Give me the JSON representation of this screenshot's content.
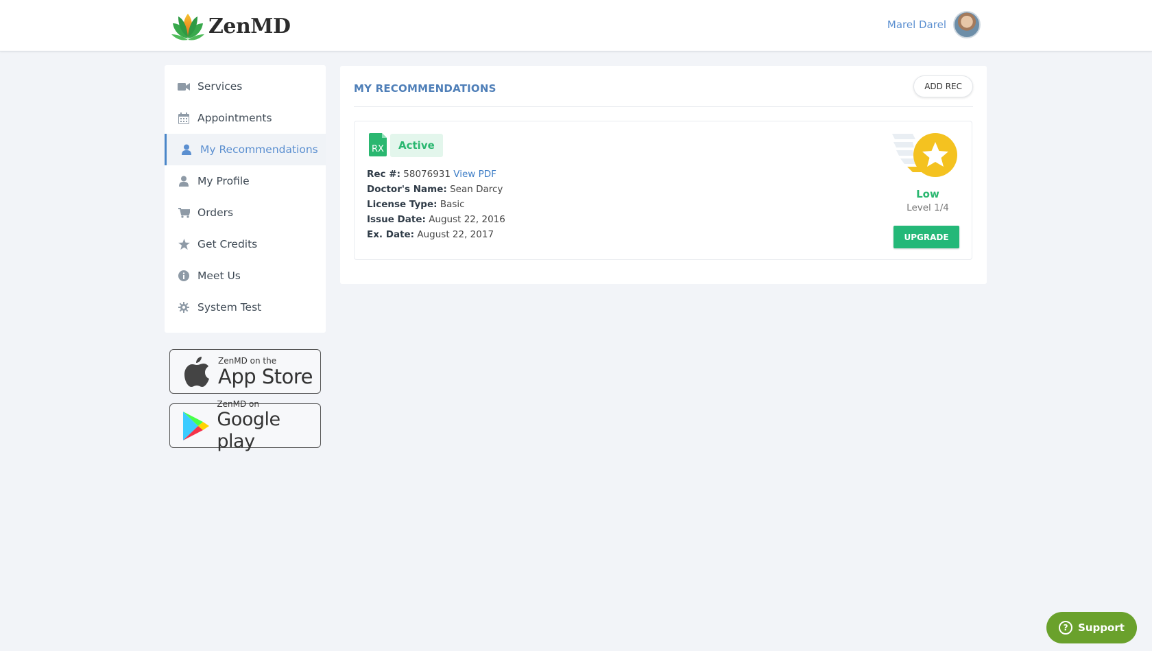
{
  "header": {
    "brand": "ZenMD",
    "user_name": "Marel Darel"
  },
  "sidebar": {
    "items": [
      {
        "label": "Services",
        "icon": "video-camera-icon"
      },
      {
        "label": "Appointments",
        "icon": "calendar-icon"
      },
      {
        "label": "My Recommendations",
        "icon": "user-icon",
        "active": true
      },
      {
        "label": "My Profile",
        "icon": "user-icon"
      },
      {
        "label": "Orders",
        "icon": "cart-icon"
      },
      {
        "label": "Get Credits",
        "icon": "star-icon"
      },
      {
        "label": "Meet Us",
        "icon": "info-icon"
      },
      {
        "label": "System Test",
        "icon": "gear-icon"
      }
    ]
  },
  "stores": {
    "apple": {
      "small": "ZenMD on the",
      "big": "App Store"
    },
    "google": {
      "small": "ZenMD on",
      "big": "Google play"
    }
  },
  "main": {
    "title": "MY RECOMMENDATIONS",
    "add_button": "ADD REC",
    "card": {
      "rx_label": "RX",
      "status": "Active",
      "rec_label": "Rec #:",
      "rec_number": "58076931",
      "view_pdf": "View PDF",
      "doctor_label": "Doctor's Name:",
      "doctor_name": "Sean Darcy",
      "license_label": "License Type:",
      "license_type": "Basic",
      "issue_label": "Issue Date:",
      "issue_date": "August 22, 2016",
      "expiry_label": "Ex. Date:",
      "expiry_date": "August 22, 2017",
      "level_name": "Low",
      "level_text": "Level 1/4",
      "upgrade_button": "UPGRADE"
    }
  },
  "support": {
    "label": "Support"
  },
  "colors": {
    "accent": "#5b8fd0",
    "success": "#24b878",
    "support": "#6aa12c"
  }
}
